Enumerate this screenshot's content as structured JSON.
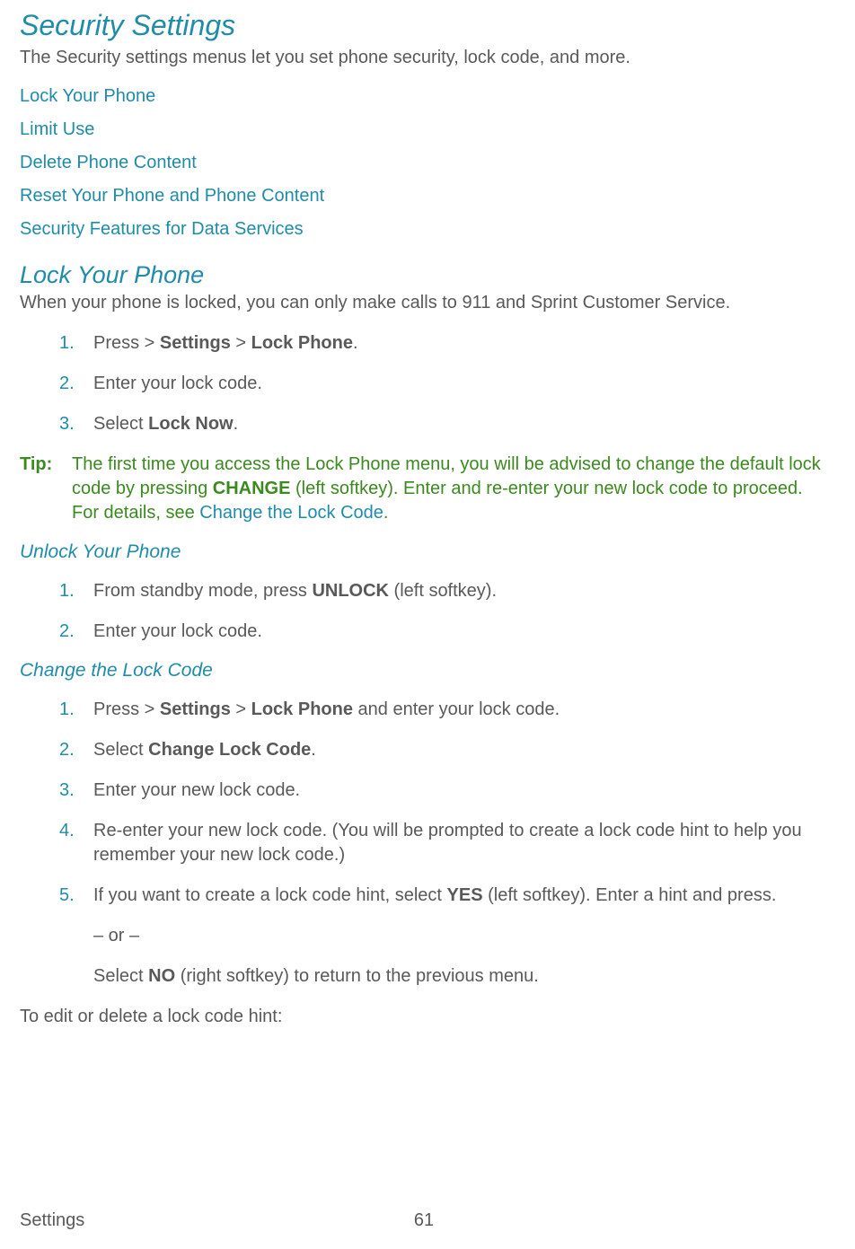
{
  "title": "Security Settings",
  "intro": "The Security settings menus let you set phone security, lock code, and more.",
  "links": {
    "lockPhone": "Lock Your Phone",
    "limitUse": "Limit Use",
    "deleteContent": "Delete Phone Content",
    "resetPhone": "Reset Your Phone and Phone Content",
    "securityData": "Security Features for Data Services"
  },
  "section_lock": {
    "heading": "Lock Your Phone",
    "intro": "When your phone is locked, you can only make calls to 911 and Sprint Customer Service.",
    "step1_a": "Press  > ",
    "step1_settings": "Settings",
    "step1_gt": " > ",
    "step1_lockphone": "Lock Phone",
    "step1_end": ".",
    "step2": "Enter your lock code.",
    "step3_a": "Select ",
    "step3_b": "Lock Now",
    "step3_c": "."
  },
  "tip": {
    "label": "Tip:",
    "t1": "The first time you access the Lock Phone menu, you will be advised to change the default lock code by pressing ",
    "t_change": "CHANGE",
    "t2": " (left softkey). Enter and re-enter your new lock code to proceed. For details, see ",
    "t_link": "Change the Lock Code",
    "t3": "."
  },
  "section_unlock": {
    "heading": "Unlock Your Phone",
    "s1a": "From standby mode, press ",
    "s1b": "UNLOCK",
    "s1c": " (left softkey).",
    "s2": "Enter your lock code."
  },
  "section_change": {
    "heading": "Change the Lock Code",
    "s1a": "Press  > ",
    "s1b": "Settings",
    "s1c": " > ",
    "s1d": "Lock Phone",
    "s1e": " and enter your lock code.",
    "s2a": "Select ",
    "s2b": "Change Lock Code",
    "s2c": ".",
    "s3": "Enter your new lock code.",
    "s4": "Re-enter your new lock code. (You will be prompted to create a lock code hint to help you remember your new lock code.)",
    "s5a": "If you want to create a lock code hint, select ",
    "s5b": "YES",
    "s5c": " (left softkey). Enter a hint and press.",
    "or": "– or –",
    "s5d": "Select ",
    "s5e": "NO",
    "s5f": " (right softkey) to return to the previous menu."
  },
  "edit_hint": "To edit or delete a lock code hint:",
  "footer": {
    "section": "Settings",
    "page": "61"
  }
}
